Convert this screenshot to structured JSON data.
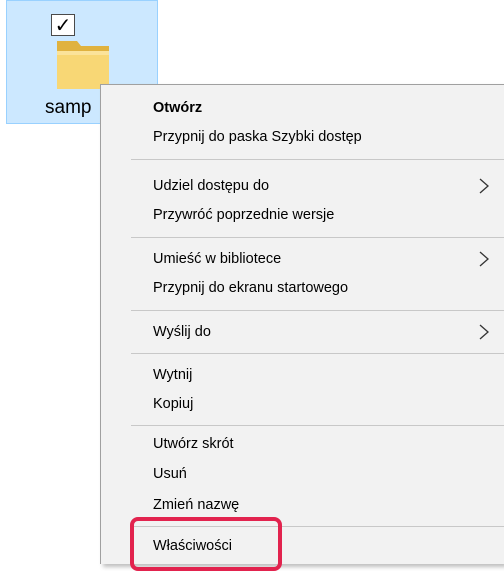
{
  "desktop": {
    "folder_label": "samp",
    "checkbox_checked": true,
    "checkmark_glyph": "✓"
  },
  "context_menu": {
    "items": [
      {
        "label": "Otwórz",
        "bold": true,
        "submenu": false
      },
      {
        "label": "Przypnij do paska Szybki dostęp",
        "bold": false,
        "submenu": false
      },
      {
        "label": "Udziel dostępu do",
        "bold": false,
        "submenu": true
      },
      {
        "label": "Przywróć poprzednie wersje",
        "bold": false,
        "submenu": false
      },
      {
        "label": "Umieść w bibliotece",
        "bold": false,
        "submenu": true
      },
      {
        "label": "Przypnij do ekranu startowego",
        "bold": false,
        "submenu": false
      },
      {
        "label": "Wyślij do",
        "bold": false,
        "submenu": true
      },
      {
        "label": "Wytnij",
        "bold": false,
        "submenu": false
      },
      {
        "label": "Kopiuj",
        "bold": false,
        "submenu": false
      },
      {
        "label": "Utwórz skrót",
        "bold": false,
        "submenu": false
      },
      {
        "label": "Usuń",
        "bold": false,
        "submenu": false
      },
      {
        "label": "Zmień nazwę",
        "bold": false,
        "submenu": false
      },
      {
        "label": "Właściwości",
        "bold": false,
        "submenu": false
      }
    ],
    "highlighted_item": "Właściwości"
  },
  "colors": {
    "selection_fill": "#cce8ff",
    "selection_border": "#99d1ff",
    "menu_background": "#f2f2f2",
    "highlight_border": "#e2234e",
    "folder_yellow": "#f8d775"
  },
  "icons": {
    "folder": "folder-icon",
    "checkbox": "checkbox-icon",
    "submenu": "chevron-right-icon"
  }
}
